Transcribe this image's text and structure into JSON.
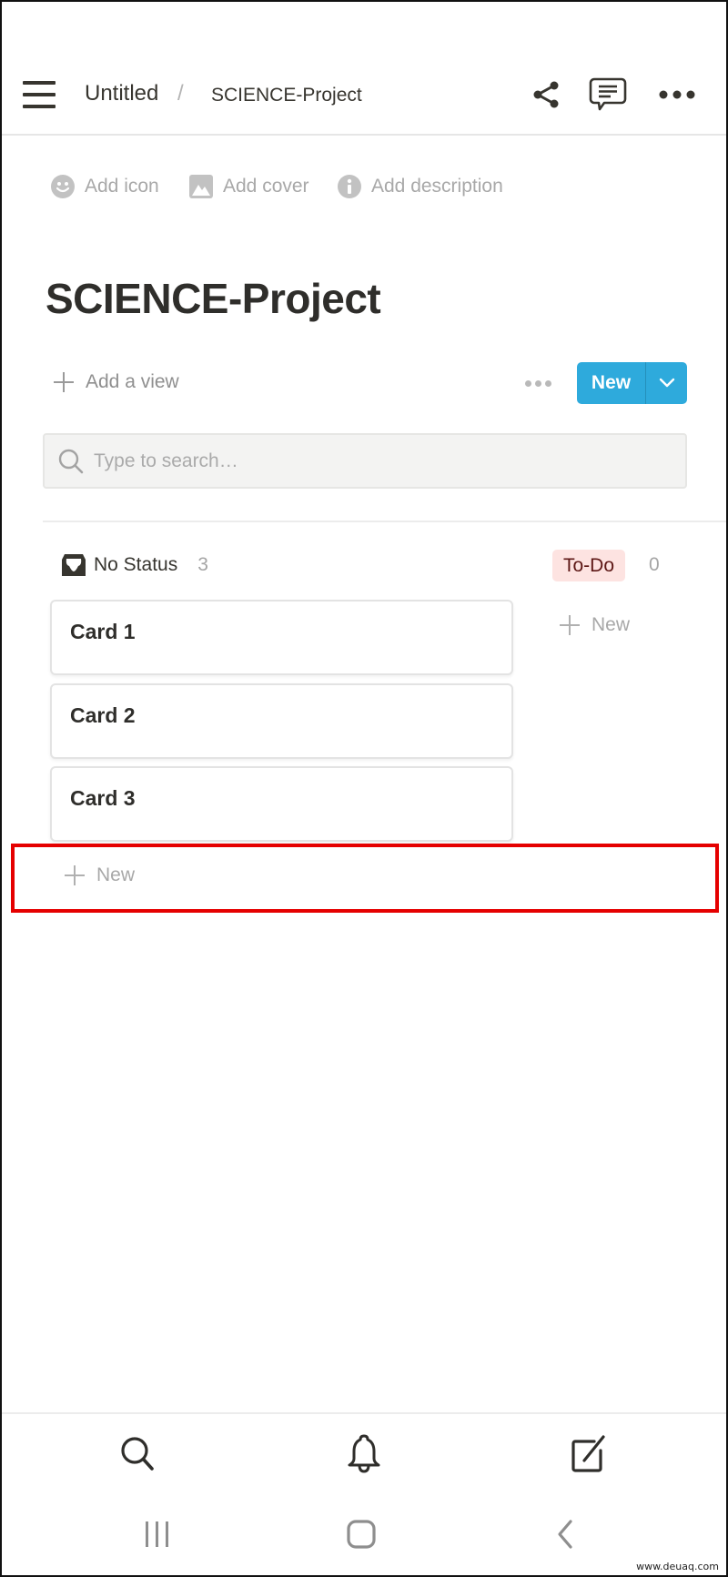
{
  "header": {
    "breadcrumb": [
      {
        "label": "Untitled"
      },
      {
        "label": "SCIENCE-Project"
      }
    ],
    "separator": "/",
    "icons": {
      "menu": "hamburger-menu-icon",
      "share": "share-icon",
      "comments": "comment-icon",
      "more": "more-horizontal-icon"
    }
  },
  "page_props": {
    "add_icon": "Add icon",
    "add_cover": "Add cover",
    "add_description": "Add description"
  },
  "page": {
    "title": "SCIENCE-Project"
  },
  "views": {
    "add_view_label": "Add a view",
    "new_button_label": "New"
  },
  "search": {
    "placeholder": "Type to search…",
    "value": ""
  },
  "board": {
    "columns": [
      {
        "name": "No Status",
        "count": "3",
        "icon": "inbox-icon",
        "cards": [
          {
            "title": "Card 1"
          },
          {
            "title": "Card 2"
          },
          {
            "title": "Card 3"
          }
        ],
        "new_label": "New"
      },
      {
        "name": "To-Do",
        "count": "0",
        "badge_bg": "#fde3e1",
        "badge_fg": "#5d1715",
        "cards": [],
        "new_label": "New"
      }
    ]
  },
  "colors": {
    "accent": "#2eaadc",
    "highlight": "#e50000"
  },
  "bottom_nav": {
    "items": [
      "search-icon",
      "bell-icon",
      "compose-icon"
    ]
  },
  "system_nav": {
    "items": [
      "recent-apps-icon",
      "home-icon",
      "back-icon"
    ]
  },
  "watermark": "www.deuaq.com"
}
